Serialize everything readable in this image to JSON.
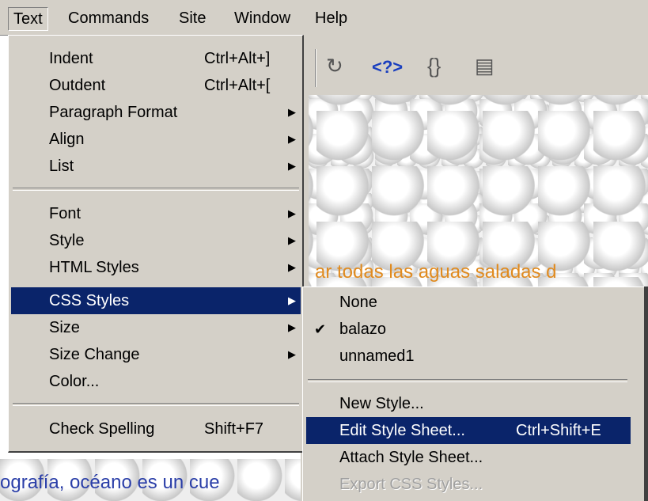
{
  "menubar": {
    "items": [
      {
        "label": "Text",
        "open": true
      },
      {
        "label": "Commands"
      },
      {
        "label": "Site"
      },
      {
        "label": "Window"
      },
      {
        "label": "Help"
      }
    ]
  },
  "toolbar": {
    "icons": [
      "refresh-icon",
      "code-tag-icon",
      "braces-icon",
      "view-options-icon"
    ]
  },
  "text_menu": {
    "items": [
      {
        "label": "Indent",
        "shortcut": "Ctrl+Alt+]"
      },
      {
        "label": "Outdent",
        "shortcut": "Ctrl+Alt+["
      },
      {
        "label": "Paragraph Format",
        "submenu": true
      },
      {
        "label": "Align",
        "submenu": true
      },
      {
        "label": "List",
        "submenu": true
      },
      {
        "label": "Font",
        "submenu": true
      },
      {
        "label": "Style",
        "submenu": true
      },
      {
        "label": "HTML Styles",
        "submenu": true
      },
      {
        "label": "CSS Styles",
        "submenu": true,
        "highlighted": true
      },
      {
        "label": "Size",
        "submenu": true
      },
      {
        "label": "Size Change",
        "submenu": true
      },
      {
        "label": "Color..."
      },
      {
        "label": "Check Spelling",
        "shortcut": "Shift+F7"
      }
    ]
  },
  "css_submenu": {
    "items": [
      {
        "label": "None"
      },
      {
        "label": "balazo",
        "checked": true
      },
      {
        "label": "unnamed1"
      },
      {
        "label": "New Style..."
      },
      {
        "label": "Edit Style Sheet...",
        "shortcut": "Ctrl+Shift+E",
        "highlighted": true
      },
      {
        "label": "Attach Style Sheet..."
      },
      {
        "label": "Export CSS Styles...",
        "disabled": true
      }
    ]
  },
  "document": {
    "orange_text": "ar todas las aguas saladas d",
    "blue_text": "ografía, océano es un cue"
  },
  "colors": {
    "menu_bg": "#d4d0c8",
    "highlight": "#0a246a",
    "orange_text": "#e08a1e",
    "blue_text": "#2a3ea8"
  }
}
